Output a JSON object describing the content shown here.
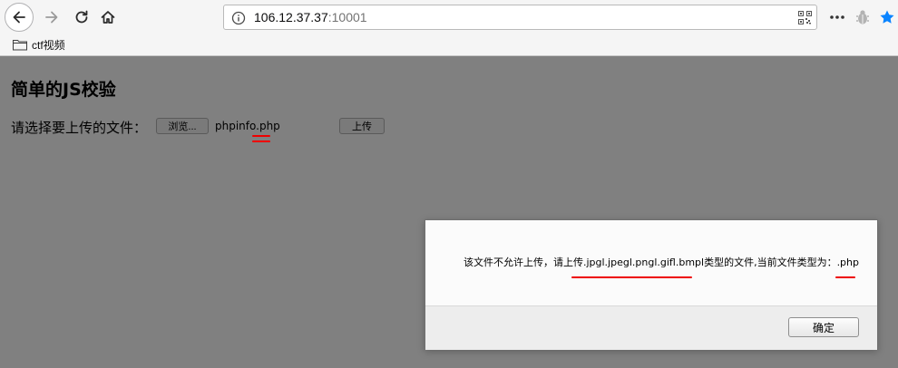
{
  "browser": {
    "url_host": "106.12.37.37",
    "url_port": ":10001",
    "bookmarks": [
      {
        "label": "ctf视频",
        "icon": "folder-icon"
      }
    ],
    "icons": {
      "back": "back-arrow-icon",
      "forward": "forward-arrow-icon",
      "reload": "reload-icon",
      "home": "home-icon",
      "info": "info-icon",
      "qr": "qr-code-icon",
      "more": "more-dots-icon",
      "extension": "bug-icon",
      "bookmark_star": "star-icon"
    },
    "colors": {
      "star": "#0a84ff"
    }
  },
  "page": {
    "title": "简单的JS校验",
    "file_label": "请选择要上传的文件：",
    "browse_label": "浏览...",
    "file_name": "phpinfo.php",
    "upload_label": "上传"
  },
  "dialog": {
    "message": "该文件不允许上传，请上传.jpgl.jpegl.pngl.gifl.bmpl类型的文件,当前文件类型为：.php",
    "ok_label": "确定"
  },
  "annotations": {
    "mark_color": "#e00000"
  }
}
